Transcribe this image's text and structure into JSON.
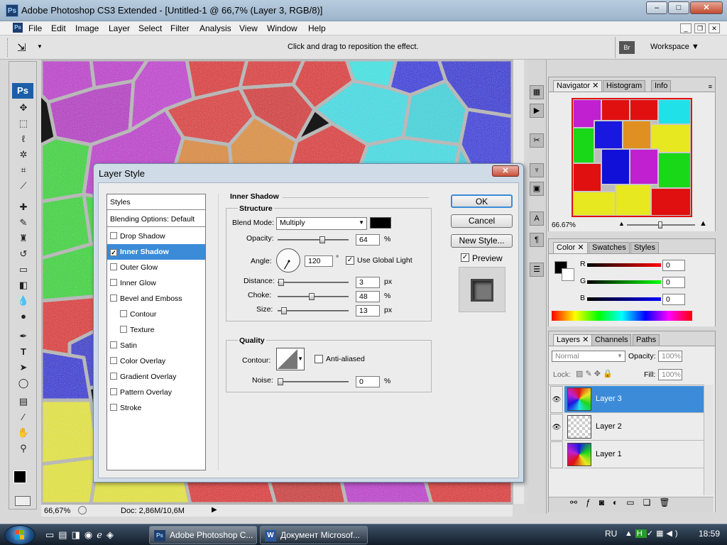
{
  "window": {
    "title": "Adobe Photoshop CS3 Extended - [Untitled-1 @ 66,7% (Layer 3, RGB/8)]",
    "logo": "Ps"
  },
  "menu": [
    "File",
    "Edit",
    "Image",
    "Layer",
    "Select",
    "Filter",
    "Analysis",
    "View",
    "Window",
    "Help"
  ],
  "options_bar": {
    "hint": "Click and drag to reposition the effect.",
    "workspace": "Workspace"
  },
  "toolbox": {
    "logo": "Ps"
  },
  "status": {
    "zoom": "66,67%",
    "doc": "Doc: 2,86M/10,6M"
  },
  "dialog": {
    "title": "Layer Style",
    "styles_header": "Styles",
    "blending": "Blending Options: Default",
    "items": [
      {
        "label": "Drop Shadow",
        "checked": false,
        "indent": false
      },
      {
        "label": "Inner Shadow",
        "checked": true,
        "indent": false
      },
      {
        "label": "Outer Glow",
        "checked": false,
        "indent": false
      },
      {
        "label": "Inner Glow",
        "checked": false,
        "indent": false
      },
      {
        "label": "Bevel and Emboss",
        "checked": false,
        "indent": false
      },
      {
        "label": "Contour",
        "checked": false,
        "indent": true
      },
      {
        "label": "Texture",
        "checked": false,
        "indent": true
      },
      {
        "label": "Satin",
        "checked": false,
        "indent": false
      },
      {
        "label": "Color Overlay",
        "checked": false,
        "indent": false
      },
      {
        "label": "Gradient Overlay",
        "checked": false,
        "indent": false
      },
      {
        "label": "Pattern Overlay",
        "checked": false,
        "indent": false
      },
      {
        "label": "Stroke",
        "checked": false,
        "indent": false
      }
    ],
    "section_title": "Inner Shadow",
    "structure": {
      "title": "Structure",
      "blend_mode_label": "Blend Mode:",
      "blend_mode": "Multiply",
      "shadow_color": "#000000",
      "opacity_label": "Opacity:",
      "opacity": "64",
      "pct": "%",
      "angle_label": "Angle:",
      "angle": "120",
      "deg": "°",
      "use_global_light": "Use Global Light",
      "distance_label": "Distance:",
      "distance": "3",
      "px": "px",
      "choke_label": "Choke:",
      "choke": "48",
      "size_label": "Size:",
      "size": "13"
    },
    "quality": {
      "title": "Quality",
      "contour_label": "Contour:",
      "anti_aliased": "Anti-aliased",
      "noise_label": "Noise:",
      "noise": "0"
    },
    "buttons": {
      "ok": "OK",
      "cancel": "Cancel",
      "new_style": "New Style...",
      "preview": "Preview"
    }
  },
  "navigator": {
    "tabs": [
      "Navigator",
      "Histogram",
      "Info"
    ],
    "zoom": "66.67%"
  },
  "color": {
    "tabs": [
      "Color",
      "Swatches",
      "Styles"
    ],
    "r_label": "R",
    "g_label": "G",
    "b_label": "B",
    "r": "0",
    "g": "0",
    "b": "0"
  },
  "layers": {
    "tabs": [
      "Layers",
      "Channels",
      "Paths"
    ],
    "mode": "Normal",
    "opacity_label": "Opacity:",
    "opacity": "100%",
    "lock_label": "Lock:",
    "fill_label": "Fill:",
    "fill": "100%",
    "items": [
      {
        "name": "Layer 3",
        "visible": true,
        "selected": true
      },
      {
        "name": "Layer 2",
        "visible": true,
        "selected": false
      },
      {
        "name": "Layer 1",
        "visible": false,
        "selected": false
      }
    ]
  },
  "taskbar": {
    "tasks": [
      "Adobe Photoshop C...",
      "Документ Microsof..."
    ],
    "lang": "RU",
    "time": "18:59"
  }
}
